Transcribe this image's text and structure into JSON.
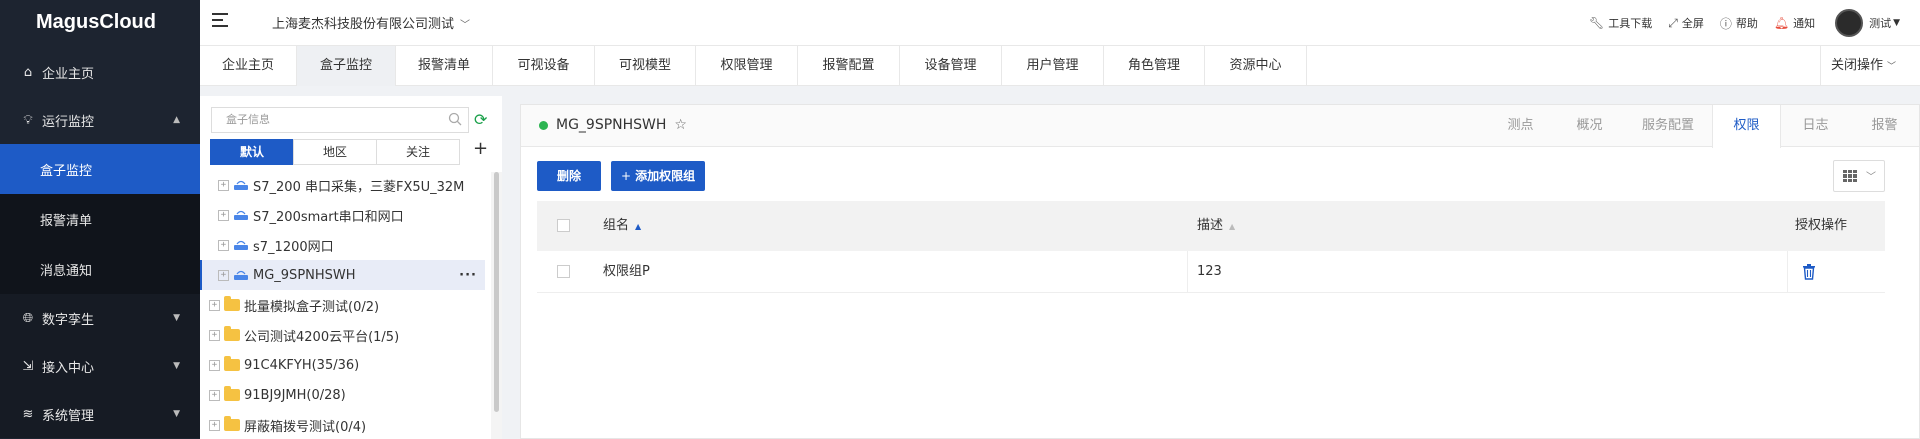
{
  "app": {
    "logo": "MagusCloud"
  },
  "sidebar": {
    "items": [
      {
        "label": "企业主页",
        "icon": "home-icon"
      },
      {
        "label": "运行监控",
        "icon": "bulb-icon",
        "expanded": true,
        "children": [
          {
            "label": "盒子监控",
            "active": true
          },
          {
            "label": "报警清单"
          },
          {
            "label": "消息通知"
          }
        ]
      },
      {
        "label": "数字孪生",
        "icon": "globe-icon"
      },
      {
        "label": "接入中心",
        "icon": "login-icon"
      },
      {
        "label": "系统管理",
        "icon": "layers-icon"
      }
    ]
  },
  "topbar": {
    "company": "上海麦杰科技股份有限公司测试",
    "tools": [
      {
        "label": "工具下载",
        "icon": "wrench-icon"
      },
      {
        "label": "全屏",
        "icon": "fullscreen-icon"
      },
      {
        "label": "帮助",
        "icon": "help-icon"
      },
      {
        "label": "通知",
        "icon": "bell-icon"
      }
    ],
    "user": "测试"
  },
  "tabs": {
    "items": [
      "企业主页",
      "盒子监控",
      "报警清单",
      "可视设备",
      "可视模型",
      "权限管理",
      "报警配置",
      "设备管理",
      "用户管理",
      "角色管理",
      "资源中心"
    ],
    "active": "盒子监控",
    "close_ops": "关闭操作"
  },
  "tree": {
    "search_placeholder": "盒子信息",
    "filters": [
      "默认",
      "地区",
      "关注"
    ],
    "active_filter": "默认",
    "devices": [
      "S7_200 串口采集，三菱FX5U_32M",
      "S7_200smart串口和网口",
      "s7_1200网口",
      "MG_9SPNHSWH"
    ],
    "selected_device": "MG_9SPNHSWH",
    "folders": [
      "批量模拟盒子测试(0/2)",
      "公司测试4200云平台(1/5)",
      "91C4KFYH(35/36)",
      "91BJ9JMH(0/28)",
      "屏蔽箱拨号测试(0/4)"
    ]
  },
  "panel": {
    "device_name": "MG_9SPNHSWH",
    "status_color": "#2db552",
    "tabs": [
      "测点",
      "概况",
      "服务配置",
      "权限",
      "日志",
      "报警"
    ],
    "active_tab": "权限",
    "buttons": {
      "delete": "删除",
      "add_group": "添加权限组"
    },
    "table": {
      "headers": {
        "name": "组名",
        "desc": "描述",
        "ops": "授权操作"
      },
      "rows": [
        {
          "name": "权限组P",
          "desc": "123"
        }
      ]
    }
  },
  "colors": {
    "accent": "#1e5bc6",
    "sidebar_bg": "#1d2430"
  }
}
